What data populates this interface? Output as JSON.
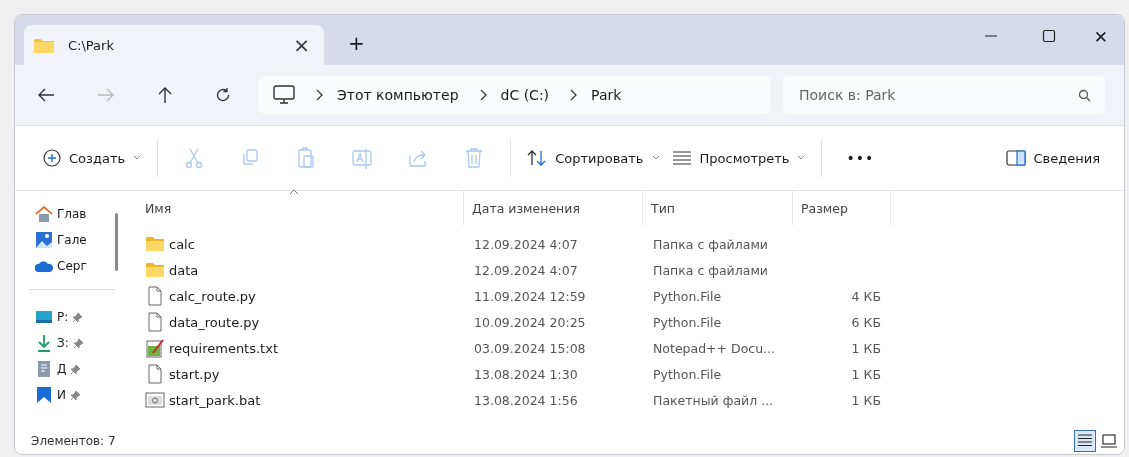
{
  "tabs": [
    {
      "label": "C:\\Park",
      "selected": true,
      "close": "×"
    }
  ],
  "new_tab": "+",
  "window_controls": {
    "close": "✕"
  },
  "nav": {
    "forward_disabled": true
  },
  "breadcrumb": [
    "Этот компьютер",
    "dC (C:)",
    "Park"
  ],
  "search": {
    "placeholder": "Поиск в: Park"
  },
  "toolbar": {
    "create": "Создать",
    "sort": "Сортировать",
    "view": "Просмотреть",
    "more": "•••",
    "details": "Сведения",
    "actions": [
      {
        "kind": "cut",
        "disabled": true
      },
      {
        "kind": "copy",
        "disabled": true
      },
      {
        "kind": "paste",
        "disabled": true
      },
      {
        "kind": "rename",
        "disabled": true
      },
      {
        "kind": "share",
        "disabled": true
      },
      {
        "kind": "delete",
        "disabled": true
      }
    ]
  },
  "sidebar": {
    "groups": [
      [
        {
          "label": "Глав",
          "kind": "home",
          "pinned": false
        },
        {
          "label": "Гале",
          "kind": "gallery",
          "pinned": false
        },
        {
          "label": "Серг",
          "kind": "cloud",
          "pinned": false
        }
      ],
      [
        {
          "label": "Р:",
          "kind": "desktop",
          "pinned": true
        },
        {
          "label": "З:",
          "kind": "download",
          "pinned": true
        },
        {
          "label": "Д",
          "kind": "documents",
          "pinned": true
        },
        {
          "label": "И",
          "kind": "pictures",
          "pinned": true
        }
      ]
    ]
  },
  "table": {
    "columns": [
      "Имя",
      "Дата изменения",
      "Тип",
      "Размер"
    ],
    "rows": [
      {
        "name": "calc",
        "kind": "folder",
        "date": "12.09.2024 4:07",
        "type": "Папка с файлами"
      },
      {
        "name": "data",
        "kind": "folder",
        "date": "12.09.2024 4:07",
        "type": "Папка с файлами"
      },
      {
        "name": "calc_route.py",
        "kind": "file",
        "date": "11.09.2024 12:59",
        "type": "Python.File",
        "size": "4 КБ"
      },
      {
        "name": "data_route.py",
        "kind": "file",
        "date": "10.09.2024 20:25",
        "type": "Python.File",
        "size": "6 КБ"
      },
      {
        "name": "requirements.txt",
        "kind": "notepad",
        "date": "03.09.2024 15:08",
        "type": "Notepad++ Docu...",
        "size": "1 КБ"
      },
      {
        "name": "start.py",
        "kind": "file",
        "date": "13.08.2024 1:30",
        "type": "Python.File",
        "size": "1 КБ"
      },
      {
        "name": "start_park.bat",
        "kind": "batch",
        "date": "13.08.2024 1:56",
        "type": "Пакетный файл ...",
        "size": "1 КБ"
      }
    ]
  },
  "status_bar": {
    "count": "Элементов: 7",
    "views": [
      {
        "kind": "details",
        "selected": true
      },
      {
        "kind": "tiles",
        "selected": false
      }
    ]
  }
}
